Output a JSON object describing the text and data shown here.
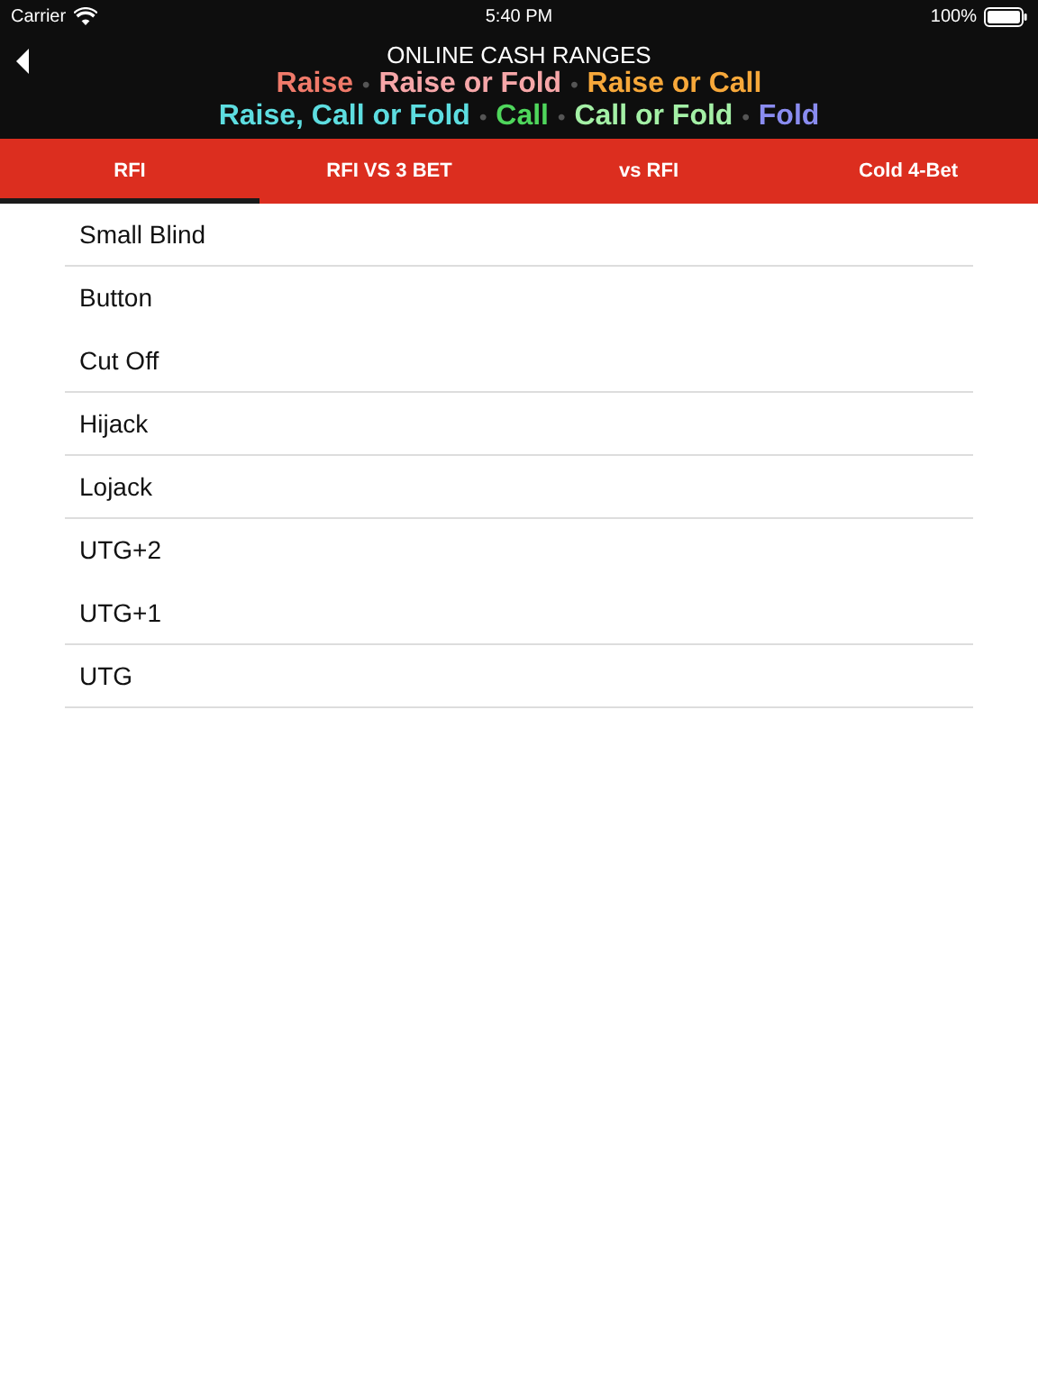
{
  "status_bar": {
    "carrier": "Carrier",
    "time": "5:40 PM",
    "battery": "100%"
  },
  "header": {
    "title": "ONLINE CASH RANGES",
    "legend_lines": [
      {
        "separator": "•",
        "items": [
          {
            "label": "Raise",
            "color": "#f07a6a"
          },
          {
            "label": "Raise or Fold",
            "color": "#f6a6a8"
          },
          {
            "label": "Raise or Call",
            "color": "#f7a83a"
          }
        ]
      },
      {
        "separator": "•",
        "items": [
          {
            "label": "Raise, Call or Fold",
            "color": "#5ddde0"
          },
          {
            "label": "Call",
            "color": "#4fd65c"
          },
          {
            "label": "Call or Fold",
            "color": "#a4f0a6"
          },
          {
            "label": "Fold",
            "color": "#8a8cf0"
          }
        ]
      }
    ]
  },
  "tabs": [
    {
      "label": "RFI",
      "selected": true
    },
    {
      "label": "RFI VS 3 BET",
      "selected": false
    },
    {
      "label": "vs RFI",
      "selected": false
    },
    {
      "label": "Cold 4-Bet",
      "selected": false
    }
  ],
  "positions": [
    {
      "label": "Small Blind",
      "separator": true
    },
    {
      "label": "Button",
      "separator": false
    },
    {
      "label": "Cut Off",
      "separator": true
    },
    {
      "label": "Hijack",
      "separator": true
    },
    {
      "label": "Lojack",
      "separator": true
    },
    {
      "label": "UTG+2",
      "separator": false
    },
    {
      "label": "UTG+1",
      "separator": true
    },
    {
      "label": "UTG",
      "separator": true
    }
  ]
}
